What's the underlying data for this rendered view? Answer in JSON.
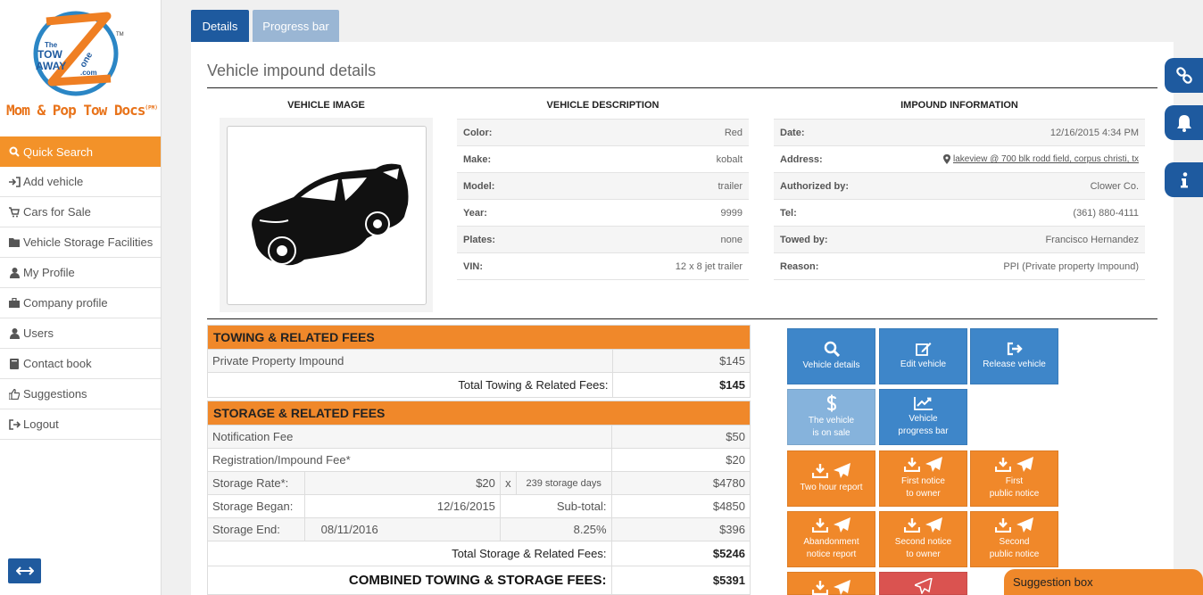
{
  "sidebar": {
    "brand": "Mom & Pop Tow Docs",
    "brand_mark": "(PM)",
    "logo_text": "The TOW AWAY Zone .com",
    "items": [
      {
        "label": "Quick Search",
        "icon": "search-icon"
      },
      {
        "label": "Add vehicle",
        "icon": "sign-in-icon"
      },
      {
        "label": "Cars for Sale",
        "icon": "cart-icon"
      },
      {
        "label": "Vehicle Storage Facilities",
        "icon": "folder-icon"
      },
      {
        "label": "My Profile",
        "icon": "user-icon"
      },
      {
        "label": "Company profile",
        "icon": "briefcase-icon"
      },
      {
        "label": "Users",
        "icon": "user-icon"
      },
      {
        "label": "Contact book",
        "icon": "book-icon"
      },
      {
        "label": "Suggestions",
        "icon": "thumbs-up-icon"
      },
      {
        "label": "Logout",
        "icon": "sign-out-icon"
      }
    ]
  },
  "tabs": [
    {
      "label": "Details"
    },
    {
      "label": "Progress bar"
    }
  ],
  "page_title": "Vehicle impound details",
  "vehicle_image": {
    "heading": "Vehicle image"
  },
  "vehicle_description": {
    "heading": "Vehicle description",
    "rows": [
      {
        "label": "Color:",
        "value": "Red"
      },
      {
        "label": "Make:",
        "value": "kobalt"
      },
      {
        "label": "Model:",
        "value": "trailer"
      },
      {
        "label": "Year:",
        "value": "9999"
      },
      {
        "label": "Plates:",
        "value": "none"
      },
      {
        "label": "VIN:",
        "value": "12 x 8 jet trailer"
      }
    ]
  },
  "impound_information": {
    "heading": "Impound information",
    "rows": [
      {
        "label": "Date:",
        "value": "12/16/2015 4:34 PM"
      },
      {
        "label": "Address:",
        "value": "lakeview @ 700 blk rodd field, corpus christi, tx"
      },
      {
        "label": "Authorized by:",
        "value": "Clower Co."
      },
      {
        "label": "Tel:",
        "value": "(361) 880-4111"
      },
      {
        "label": "Towed by:",
        "value": "Francisco Hernandez"
      },
      {
        "label": "Reason:",
        "value": "PPI (Private property Impound)"
      }
    ]
  },
  "towing_fees": {
    "heading": "TOWING & RELATED FEES",
    "items": [
      {
        "label": "Private Property Impound",
        "value": "$145"
      }
    ],
    "total_label": "Total Towing & Related Fees:",
    "total_value": "$145"
  },
  "storage_fees": {
    "heading": "STORAGE & RELATED FEES",
    "notification_label": "Notification Fee",
    "notification_value": "$50",
    "registration_label": "Registration/Impound Fee*",
    "registration_value": "$20",
    "rate_label": "Storage Rate*:",
    "rate_value": "$20",
    "rate_x": "x",
    "rate_days": "239 storage days",
    "rate_total": "$4780",
    "began_label": "Storage Began:",
    "began_value": "12/16/2015",
    "subtotal_label": "Sub-total:",
    "subtotal_value": "$4850",
    "end_label": "Storage End:",
    "end_value": "08/11/2016",
    "tax_rate": "8.25%",
    "tax_value": "$396",
    "total_label": "Total Storage & Related Fees:",
    "total_value": "$5246"
  },
  "combined": {
    "label": "COMBINED TOWING & STORAGE FEES:",
    "value": "$5391"
  },
  "actions": {
    "vehicle_details": "Vehicle details",
    "edit_vehicle": "Edit vehicle",
    "release_vehicle": "Release vehicle",
    "on_sale_1": "The vehicle",
    "on_sale_2": "is on sale",
    "progress_1": "Vehicle",
    "progress_2": "progress bar",
    "two_hour": "Two hour report",
    "first_owner_1": "First notice",
    "first_owner_2": "to owner",
    "first_public_1": "First",
    "first_public_2": "public notice",
    "abandon_1": "Abandonment",
    "abandon_2": "notice report",
    "second_owner_1": "Second notice",
    "second_owner_2": "to owner",
    "second_public_1": "Second",
    "second_public_2": "public notice"
  },
  "float_tabs": [
    {
      "icon": "link-icon"
    },
    {
      "icon": "bell-icon"
    },
    {
      "icon": "info-icon"
    }
  ],
  "suggestion_box": "Suggestion box",
  "colors": {
    "accent_orange": "#f0882a",
    "primary_blue": "#1e5a9f",
    "button_blue": "#3e86c9"
  }
}
